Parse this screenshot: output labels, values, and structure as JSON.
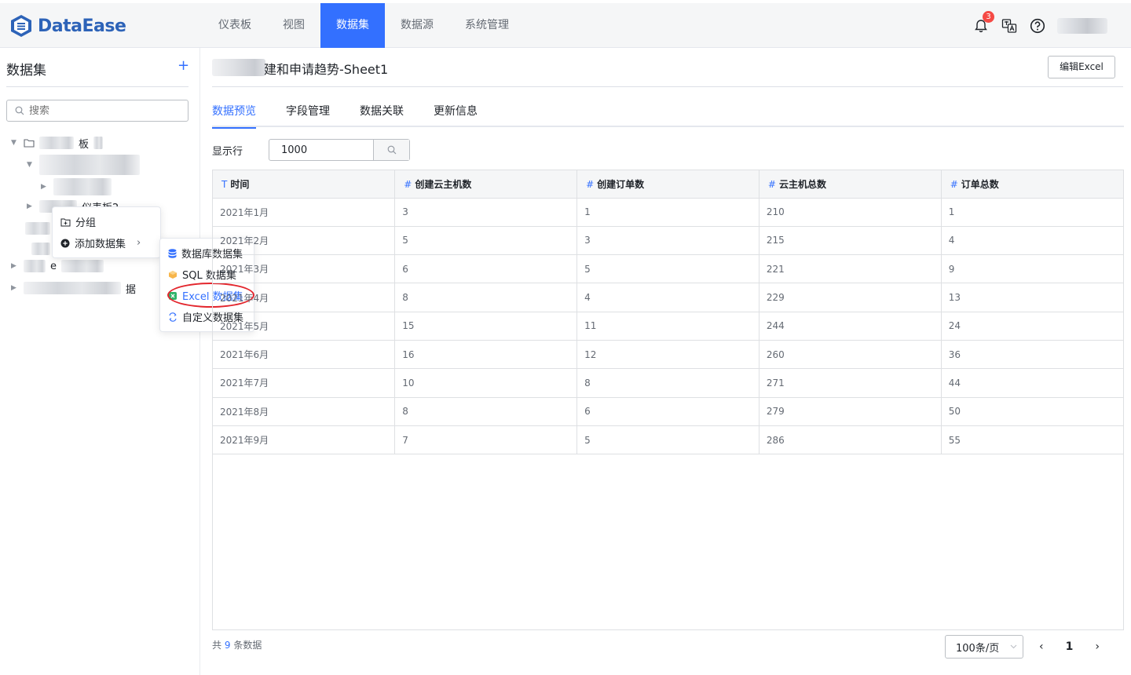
{
  "brand": {
    "name": "DataEase",
    "color": "#2d63b8"
  },
  "nav": {
    "items": [
      {
        "label": "仪表板",
        "active": false
      },
      {
        "label": "视图",
        "active": false
      },
      {
        "label": "数据集",
        "active": true
      },
      {
        "label": "数据源",
        "active": false
      },
      {
        "label": "系统管理",
        "active": false
      }
    ],
    "notification_count": "3"
  },
  "sidebar": {
    "title": "数据集",
    "add_symbol": "+",
    "search_placeholder": "搜索",
    "tree_visible_fragments": [
      "板",
      "仪表板2",
      "e",
      "据"
    ]
  },
  "context_menu": {
    "items": [
      {
        "label": "分组",
        "icon": "folder-plus-icon"
      },
      {
        "label": "添加数据集",
        "icon": "add-circle-icon"
      }
    ],
    "submenu": [
      {
        "label": "数据库数据集",
        "icon": "database-icon"
      },
      {
        "label": "SQL 数据集",
        "icon": "sql-icon"
      },
      {
        "label": "Excel 数据集",
        "icon": "excel-icon",
        "highlighted": true
      },
      {
        "label": "自定义数据集",
        "icon": "custom-icon"
      }
    ]
  },
  "main": {
    "title": "建和申请趋势-Sheet1",
    "edit_button": "编辑Excel",
    "tabs": [
      "数据预览",
      "字段管理",
      "数据关联",
      "更新信息"
    ],
    "active_tab": "数据预览",
    "rows_label": "显示行",
    "rows_value": "1000"
  },
  "table": {
    "columns": [
      {
        "type": "T",
        "name": "时间"
      },
      {
        "type": "#",
        "name": "创建云主机数"
      },
      {
        "type": "#",
        "name": "创建订单数"
      },
      {
        "type": "#",
        "name": "云主机总数"
      },
      {
        "type": "#",
        "name": "订单总数"
      }
    ],
    "rows": [
      [
        "2021年1月",
        "3",
        "1",
        "210",
        "1"
      ],
      [
        "2021年2月",
        "5",
        "3",
        "215",
        "4"
      ],
      [
        "2021年3月",
        "6",
        "5",
        "221",
        "9"
      ],
      [
        "2021年4月",
        "8",
        "4",
        "229",
        "13"
      ],
      [
        "2021年5月",
        "15",
        "11",
        "244",
        "24"
      ],
      [
        "2021年6月",
        "16",
        "12",
        "260",
        "36"
      ],
      [
        "2021年7月",
        "10",
        "8",
        "271",
        "44"
      ],
      [
        "2021年8月",
        "8",
        "6",
        "279",
        "50"
      ],
      [
        "2021年9月",
        "7",
        "5",
        "286",
        "55"
      ]
    ]
  },
  "footer": {
    "count_prefix": "共",
    "count": "9",
    "count_suffix": "条数据",
    "page_size": "100条/页",
    "prev": "‹",
    "current_page": "1",
    "next": "›"
  },
  "colors": {
    "accent": "#3370ff",
    "annotation_ring": "#e3262d",
    "badge": "#f54a45"
  }
}
